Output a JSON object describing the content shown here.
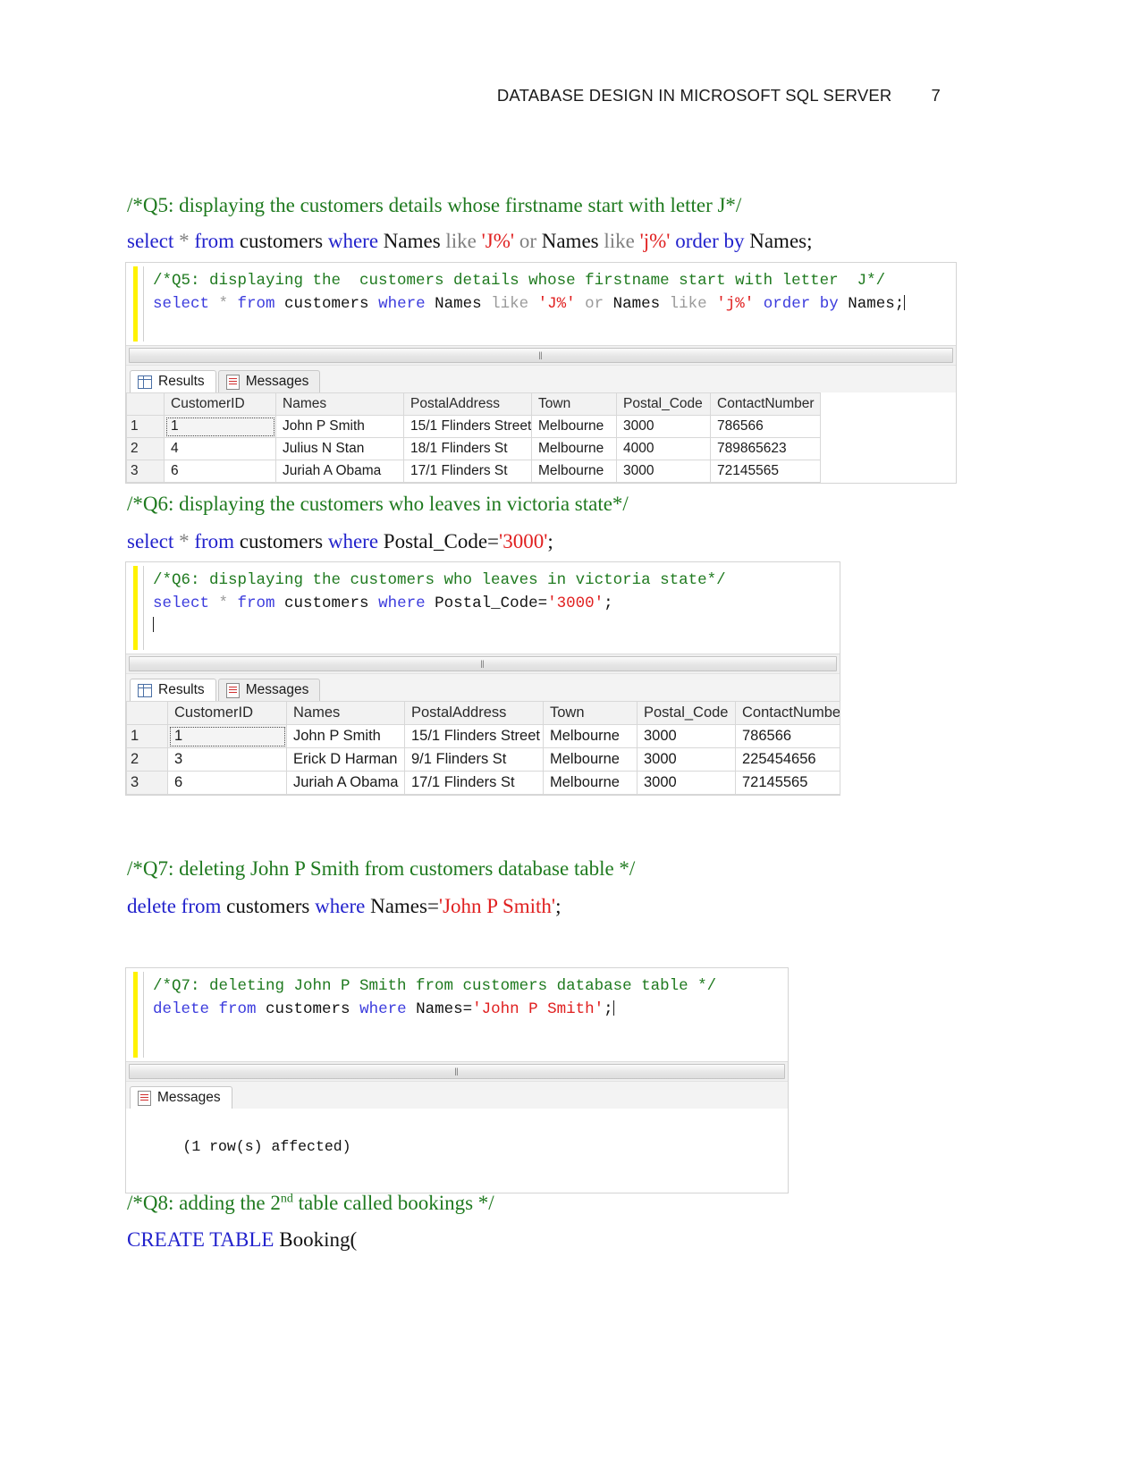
{
  "header": {
    "title": "DATABASE DESIGN IN MICROSOFT SQL SERVER",
    "page_number": "7"
  },
  "q5": {
    "comment": "/*Q5: displaying the  customers details whose firstname start with letter  J*/",
    "sql_tokens": {
      "select": "select",
      "star": "*",
      "from": "from",
      "customers": "customers",
      "where": "where",
      "names1": "Names",
      "like1": "like",
      "pattern1": "'J%'",
      "or": "or",
      "names2": "Names",
      "like2": "like",
      "pattern2": "'j%'",
      "orderby": "order by",
      "names3": "Names;"
    },
    "editor": {
      "line1_comment": "/*Q5: displaying the  customers details whose firstname start with letter  J*/",
      "line2": {
        "select": "select",
        "star": " * ",
        "from": "from",
        "customers": " customers ",
        "where": "where",
        "names1": " Names ",
        "like1": "like",
        "pattern1": " 'J%' ",
        "or": "or",
        "names2": " Names ",
        "like2": "like",
        "pattern2": " 'j%' ",
        "orderby": "order by",
        "names3": " Names;"
      }
    },
    "tabs": [
      {
        "label": "Results",
        "icon": "grid-icon",
        "active": true
      },
      {
        "label": "Messages",
        "icon": "messages-icon",
        "active": false
      }
    ],
    "grid": {
      "row_header": "",
      "columns": [
        "CustomerID",
        "Names",
        "PostalAddress",
        "Town",
        "Postal_Code",
        "ContactNumber"
      ],
      "rows": [
        {
          "n": "1",
          "cells": [
            "1",
            "John P Smith",
            "15/1 Flinders Street",
            "Melbourne",
            "3000",
            "786566"
          ]
        },
        {
          "n": "2",
          "cells": [
            "4",
            "Julius N Stan",
            "18/1 Flinders St",
            "Melbourne",
            "4000",
            "789865623"
          ]
        },
        {
          "n": "3",
          "cells": [
            "6",
            "Juriah A Obama",
            "17/1 Flinders St",
            "Melbourne",
            "3000",
            "72145565"
          ]
        }
      ]
    },
    "scrollbar_grip": "‖"
  },
  "q6": {
    "comment": "/*Q6: displaying the customers who leaves in victoria state*/",
    "sql_tokens": {
      "select": "select",
      "star": "*",
      "from": "from",
      "customers": "customers",
      "where": "where",
      "column": "Postal_Code=",
      "value": "'3000'",
      "semicolon": ";"
    },
    "editor": {
      "line1_comment": "/*Q6: displaying the customers who leaves in victoria state*/",
      "line2": {
        "select": "select",
        "star": " * ",
        "from": "from",
        "customers": " customers ",
        "where": "where",
        "column": " Postal_Code=",
        "value": "'3000'",
        "semicolon": ";"
      }
    },
    "tabs": [
      {
        "label": "Results",
        "icon": "grid-icon",
        "active": true
      },
      {
        "label": "Messages",
        "icon": "messages-icon",
        "active": false
      }
    ],
    "grid": {
      "columns": [
        "CustomerID",
        "Names",
        "PostalAddress",
        "Town",
        "Postal_Code",
        "ContactNumber"
      ],
      "rows": [
        {
          "n": "1",
          "cells": [
            "1",
            "John P Smith",
            "15/1 Flinders Street",
            "Melbourne",
            "3000",
            "786566"
          ]
        },
        {
          "n": "2",
          "cells": [
            "3",
            "Erick D Harman",
            "9/1 Flinders St",
            "Melbourne",
            "3000",
            "225454656"
          ]
        },
        {
          "n": "3",
          "cells": [
            "6",
            "Juriah A Obama",
            "17/1 Flinders St",
            "Melbourne",
            "3000",
            "72145565"
          ]
        }
      ]
    },
    "scrollbar_grip": "‖"
  },
  "q7": {
    "comment": "/*Q7: deleting John P Smith from customers database table */",
    "sql_tokens": {
      "delete": "delete",
      "from": "from",
      "customers": "customers",
      "where": "where",
      "names": "Names=",
      "value": "'John P Smith'",
      "semicolon": ";"
    },
    "editor": {
      "line1_comment": "/*Q7: deleting John P Smith from customers database table */",
      "line2": {
        "delete": "delete",
        "from": " from",
        "customers": " customers ",
        "where": "where",
        "names": " Names=",
        "value": "'John P Smith'",
        "semicolon": ";"
      }
    },
    "tabs": [
      {
        "label": "Messages",
        "icon": "messages-icon",
        "active": true
      }
    ],
    "message_output": "(1 row(s) affected)",
    "scrollbar_grip": "‖"
  },
  "q8": {
    "comment_part1": "/*Q8: adding the  2",
    "comment_sup": "nd",
    "comment_part2": " table called bookings */",
    "sql_tokens": {
      "create_table": "CREATE TABLE",
      "booking": "Booking("
    }
  },
  "colors": {
    "comment_green": "#1f7a1f",
    "keyword_blue": "#2222cc",
    "string_red": "#e02020",
    "operator_gray": "#808080",
    "modified_bar_yellow": "#fff200"
  }
}
